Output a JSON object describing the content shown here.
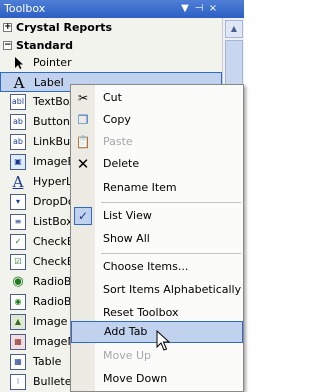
{
  "window": {
    "title": "Toolbox",
    "buttons": {
      "dropdown": "▼",
      "pin": "⊣",
      "close": "×"
    }
  },
  "categories": [
    {
      "label": "Crystal Reports",
      "sign": "+"
    },
    {
      "label": "Standard",
      "sign": "−"
    }
  ],
  "tools": [
    {
      "label": "Pointer",
      "icon": "pointer-icon"
    },
    {
      "label": "Label",
      "icon": "label-icon"
    },
    {
      "label": "TextBox",
      "icon": "textbox-icon"
    },
    {
      "label": "Button",
      "icon": "button-icon"
    },
    {
      "label": "LinkButt",
      "icon": "linkbutton-icon"
    },
    {
      "label": "ImageB",
      "icon": "imagebutton-icon"
    },
    {
      "label": "HyperLi",
      "icon": "hyperlink-icon"
    },
    {
      "label": "DropDo",
      "icon": "dropdownlist-icon"
    },
    {
      "label": "ListBox",
      "icon": "listbox-icon"
    },
    {
      "label": "CheckBo",
      "icon": "checkbox-icon"
    },
    {
      "label": "CheckBo",
      "icon": "checkboxlist-icon"
    },
    {
      "label": "RadioBu",
      "icon": "radiobutton-icon"
    },
    {
      "label": "RadioBu",
      "icon": "radiobuttonlist-icon"
    },
    {
      "label": "Image",
      "icon": "image-icon"
    },
    {
      "label": "ImageM",
      "icon": "imagemap-icon"
    },
    {
      "label": "Table",
      "icon": "table-icon"
    },
    {
      "label": "Bulleted",
      "icon": "bulletedlist-icon"
    }
  ],
  "selected_tool": "Label",
  "context_menu": {
    "items": [
      {
        "label": "Cut",
        "icon": "cut-icon",
        "enabled": true
      },
      {
        "label": "Copy",
        "icon": "copy-icon",
        "enabled": true
      },
      {
        "label": "Paste",
        "icon": "paste-icon",
        "enabled": false
      },
      {
        "label": "Delete",
        "icon": "delete-icon",
        "enabled": true
      },
      {
        "label": "Rename Item",
        "enabled": true
      },
      {
        "label": "List View",
        "checked": true,
        "enabled": true
      },
      {
        "label": "Show All",
        "enabled": true
      },
      {
        "label": "Choose Items...",
        "enabled": true
      },
      {
        "label": "Sort Items Alphabetically",
        "enabled": true
      },
      {
        "label": "Reset Toolbox",
        "enabled": true
      },
      {
        "label": "Add Tab",
        "enabled": true,
        "highlighted": true
      },
      {
        "label": "Move Up",
        "enabled": false
      },
      {
        "label": "Move Down",
        "enabled": true
      }
    ]
  },
  "colors": {
    "title_bar": "#2b5fc4",
    "selection": "#c1d2ee",
    "selection_border": "#316ac5",
    "disabled_text": "#a7a6aa"
  }
}
